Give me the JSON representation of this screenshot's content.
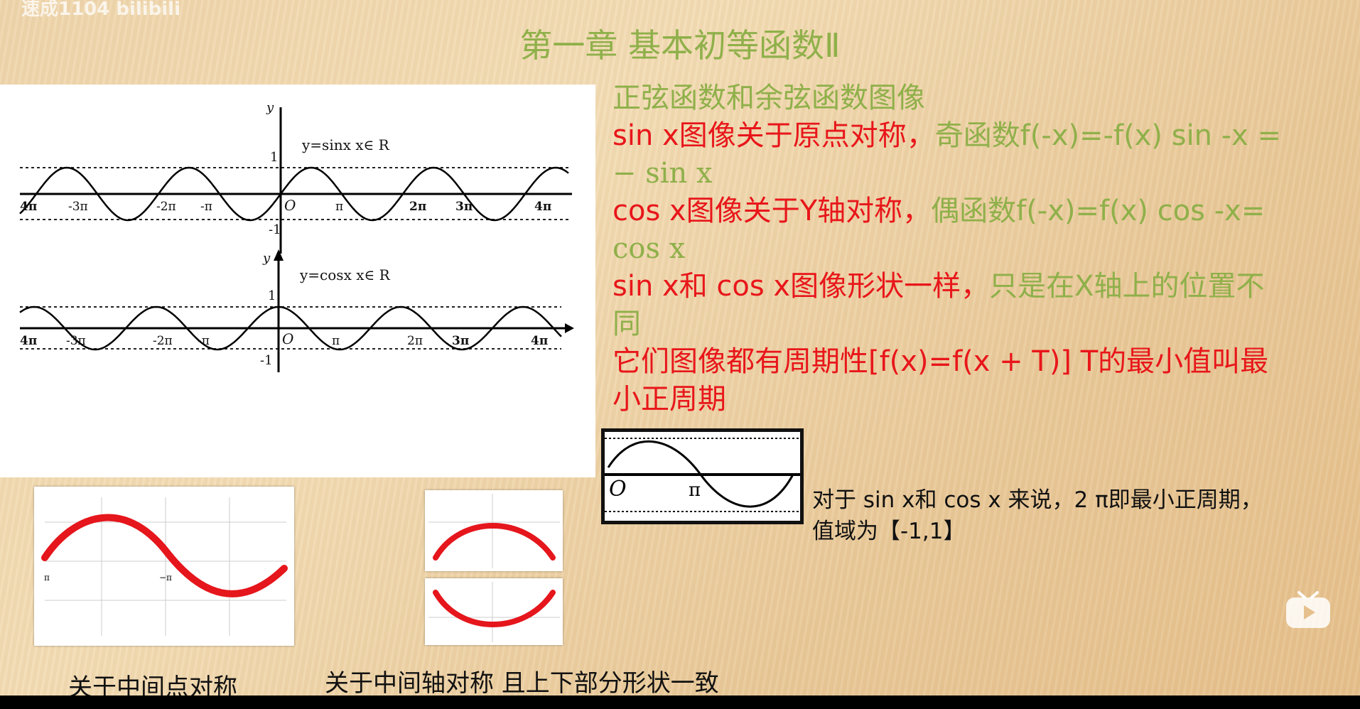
{
  "watermark": "速成1104 bilibili",
  "title": "第一章 基本初等函数Ⅱ",
  "graph_panel": {
    "sin_graph": {
      "label": "y=sinx   x∈ R",
      "y_axis": "y",
      "y_top": "1",
      "y_bottom": "-1",
      "origin": "O",
      "ticks": [
        "4π",
        "-3π",
        "-2π",
        "-π",
        "π",
        "2π",
        "3π",
        "4π"
      ]
    },
    "cos_graph": {
      "label": "y=cosx   x∈ R",
      "y_axis": "y",
      "y_top": "1",
      "y_bottom": "-1",
      "origin": "O",
      "ticks": [
        "4π",
        "-3π",
        "-2π",
        "-π",
        "π",
        "2π",
        "3π",
        "4π"
      ]
    }
  },
  "notes": {
    "heading": "正弦函数和余弦函数图像",
    "sin_a": "sin x图像关于原点对称，",
    "sin_b": "奇函数f(-x)=-f(x) sin -x =",
    "sin_c": "− sin x",
    "cos_a": "cos x图像关于Y轴对称，",
    "cos_b": "偶函数f(-x)=f(x) cos -x=",
    "cos_c": "cos x",
    "shape_a": "sin x和 cos x图像形状一样，",
    "shape_b": "只是在X轴上的位置不",
    "shape_c": "同",
    "period_a": "它们图像都有周期性[f(x)=f(x + T)]   T的最小值叫最",
    "period_b": "小正周期"
  },
  "mini_graph": {
    "origin": "O",
    "pi": "π"
  },
  "mini_note": {
    "line1": "对于 sin x和 cos x 来说，2 π即最小正周期，",
    "line2": "值域为【-1,1】"
  },
  "thumb_left": {
    "left_label": "π",
    "mid_label": "−π"
  },
  "captions": {
    "left": "关于中间点对称",
    "right": "关于中间轴对称 且上下部分形状一致"
  },
  "icons": {
    "play": "tv-play-icon"
  },
  "colors": {
    "green": "#8fb04a",
    "red": "#e8161a",
    "curve_red": "#e5161c"
  }
}
